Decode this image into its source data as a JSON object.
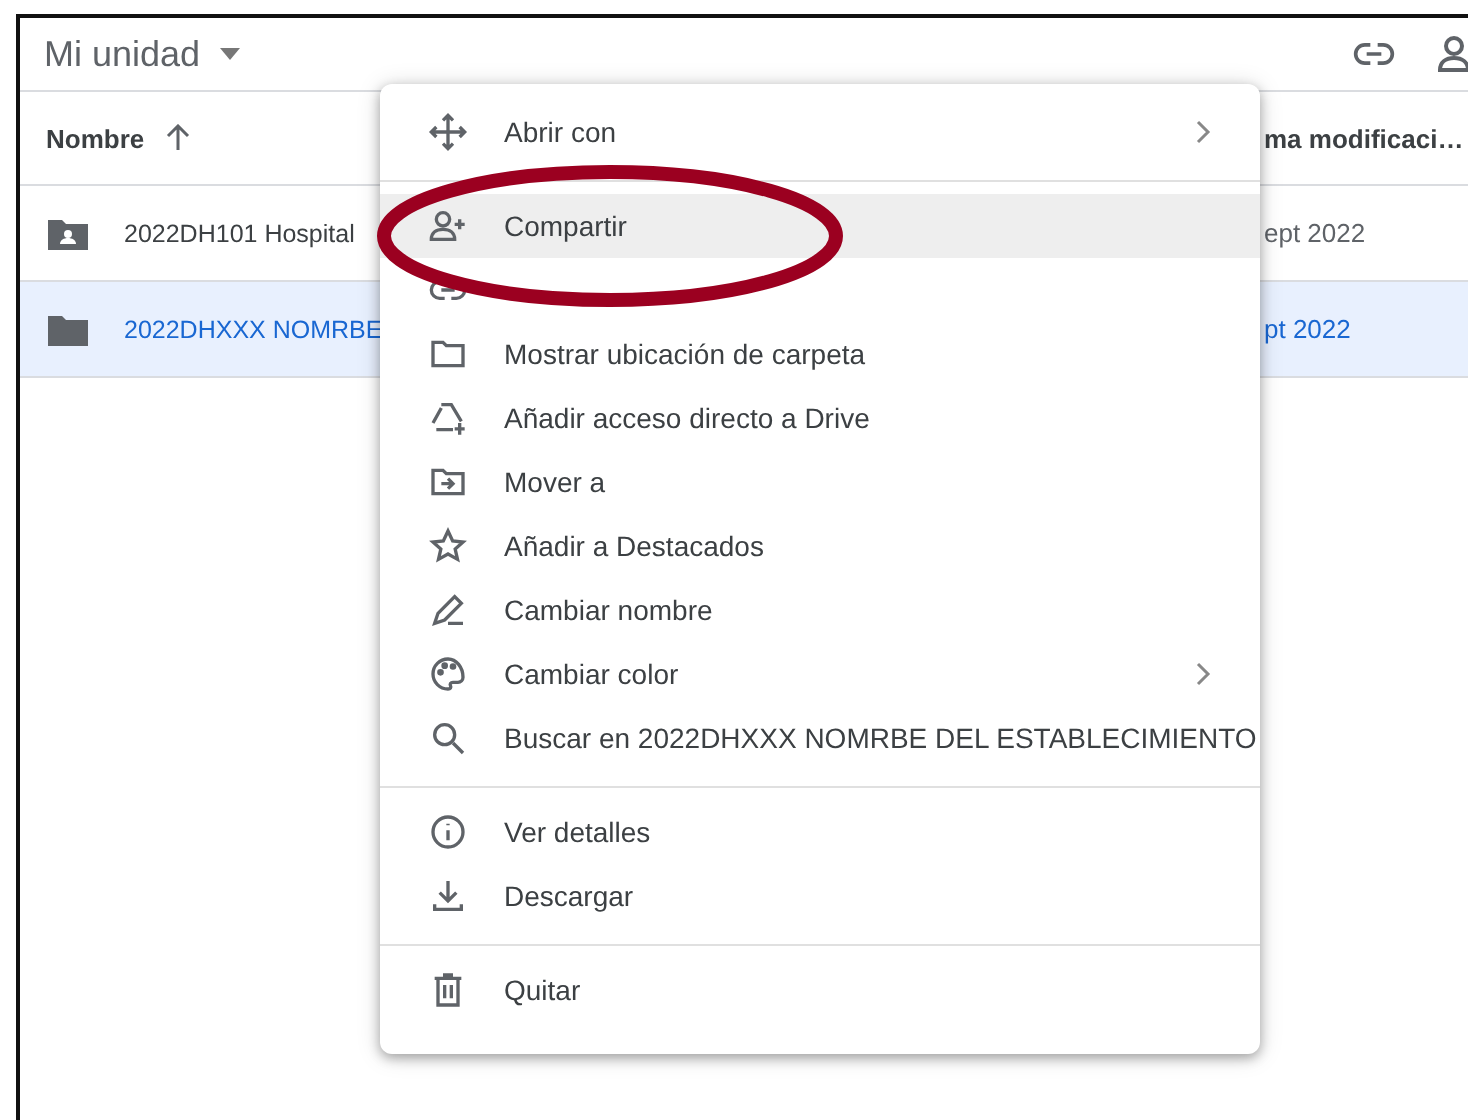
{
  "header": {
    "title": "Mi unidad"
  },
  "columns": {
    "name": "Nombre",
    "modified": "ma modificaci…"
  },
  "files": [
    {
      "name": "2022DH101 Hospital",
      "modified": "ept 2022",
      "kind": "shared",
      "selected": false
    },
    {
      "name": "2022DHXXX NOMRBE",
      "modified": "pt 2022",
      "kind": "folder",
      "selected": true
    }
  ],
  "menu": [
    {
      "kind": "open",
      "label": "Abrir con",
      "submenu": true,
      "highlighted": false
    },
    {
      "kind": "divider"
    },
    {
      "kind": "share",
      "label": "Compartir",
      "submenu": false,
      "highlighted": true
    },
    {
      "kind": "link",
      "submenu": false,
      "highlighted": false
    },
    {
      "kind": "folder",
      "label": "Mostrar ubicación de carpeta",
      "submenu": false,
      "highlighted": false
    },
    {
      "kind": "shortcut",
      "label": "Añadir acceso directo a Drive",
      "submenu": false,
      "highlighted": false
    },
    {
      "kind": "move",
      "label": "Mover a",
      "submenu": false,
      "highlighted": false
    },
    {
      "kind": "star",
      "label": "Añadir a Destacados",
      "submenu": false,
      "highlighted": false
    },
    {
      "kind": "rename",
      "label": "Cambiar nombre",
      "submenu": false,
      "highlighted": false
    },
    {
      "kind": "palette",
      "label": "Cambiar color",
      "submenu": true,
      "highlighted": false
    },
    {
      "kind": "search",
      "label": "Buscar en 2022DHXXX NOMRBE DEL ESTABLECIMIENTO",
      "submenu": false,
      "highlighted": false
    },
    {
      "kind": "divider"
    },
    {
      "kind": "info",
      "label": "Ver detalles",
      "submenu": false,
      "highlighted": false
    },
    {
      "kind": "download",
      "label": "Descargar",
      "submenu": false,
      "highlighted": false
    },
    {
      "kind": "divider"
    },
    {
      "kind": "trash",
      "label": "Quitar",
      "submenu": false,
      "highlighted": false
    }
  ]
}
